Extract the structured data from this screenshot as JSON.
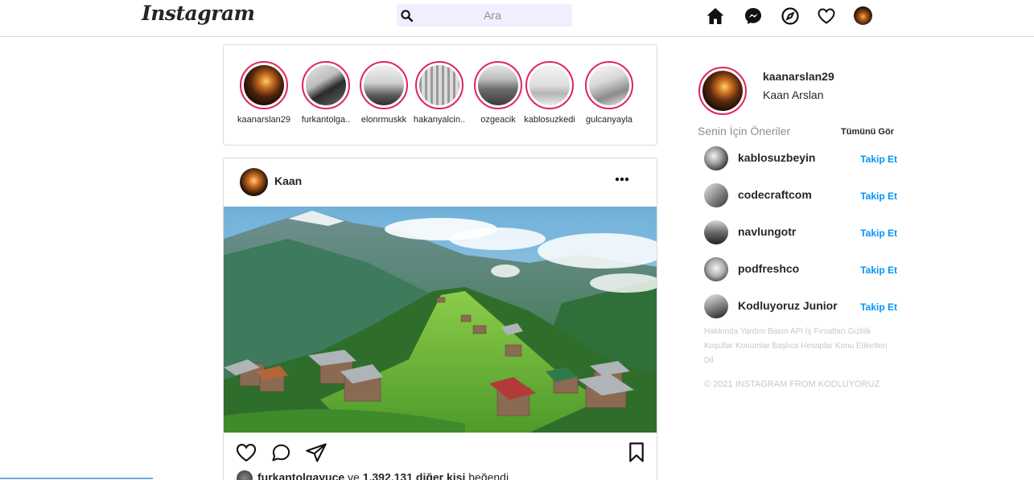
{
  "header": {
    "logo": "Instagram",
    "search_placeholder": "Ara",
    "nav_icons": [
      "home-icon",
      "messenger-icon",
      "explore-icon",
      "heart-icon",
      "profile-avatar"
    ]
  },
  "stories": [
    {
      "name": "kaanarslan29"
    },
    {
      "name": "furkantolga.."
    },
    {
      "name": "elonrmuskk"
    },
    {
      "name": "hakanyalcin.."
    },
    {
      "name": "ozgeacik"
    },
    {
      "name": "kablosuzkedi"
    },
    {
      "name": "gulcanyayla"
    }
  ],
  "post": {
    "user": "Kaan",
    "liked_by_user": "furkantolgayuce",
    "liked_connector": "ve",
    "liked_others": "1.392.131 diğer kişi",
    "liked_suffix": "beğendi"
  },
  "sidebar": {
    "username": "kaanarslan29",
    "full_name": "Kaan Arslan",
    "suggestions_title": "Senin İçin Öneriler",
    "see_all": "Tümünü Gör",
    "suggestions": [
      {
        "username": "kablosuzbeyin",
        "follow": "Takip Et"
      },
      {
        "username": "codecraftcom",
        "follow": "Takip Et"
      },
      {
        "username": "navlungotr",
        "follow": "Takip Et"
      },
      {
        "username": "podfreshco",
        "follow": "Takip Et"
      },
      {
        "username": "Kodluyoruz Junior",
        "follow": "Takip Et"
      }
    ],
    "footer_links": "Hakkında Yardım Basın API İş Fırsatları Gizlilik Koşullar Konumlar Başlıca Hesaplar Konu Etiketleri Dil",
    "copyright": "© 2021 INSTAGRAM FROM KODLUYORUZ"
  },
  "colors": {
    "story_ring": "#e0245e",
    "follow_blue": "#0095f6",
    "border": "#dbdbdb",
    "search_bg": "#efefff"
  }
}
